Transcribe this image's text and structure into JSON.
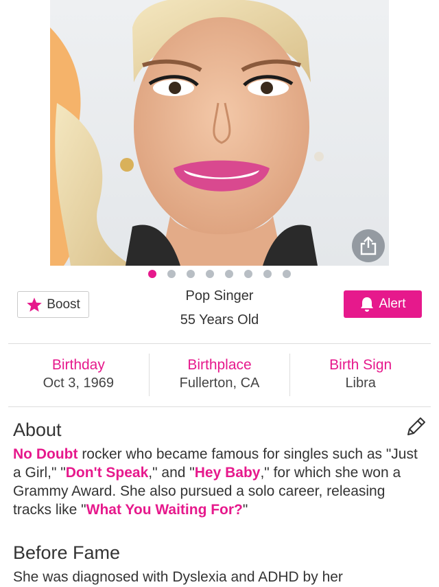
{
  "colors": {
    "accent": "#e6198c",
    "divider": "#dcdcdc",
    "text": "#333333"
  },
  "carousel": {
    "total": 8,
    "active_index": 0
  },
  "actions": {
    "boost_label": "Boost",
    "alert_label": "Alert"
  },
  "profile": {
    "occupation": "Pop Singer",
    "age": "55 Years Old"
  },
  "facts": [
    {
      "label": "Birthday",
      "value": "Oct 3, 1969"
    },
    {
      "label": "Birthplace",
      "value": "Fullerton, CA"
    },
    {
      "label": "Birth Sign",
      "value": "Libra"
    }
  ],
  "about": {
    "title": "About",
    "segments": [
      {
        "text": "No Doubt",
        "link": true
      },
      {
        "text": " rocker who became famous for singles such as \"Just a Girl,\" \"",
        "link": false
      },
      {
        "text": "Don't Speak",
        "link": true
      },
      {
        "text": ",\" and \"",
        "link": false
      },
      {
        "text": "Hey Baby",
        "link": true
      },
      {
        "text": ",\" for which she won a Grammy Award. She also pursued a solo career, releasing tracks like \"",
        "link": false
      },
      {
        "text": "What You Waiting For?",
        "link": true
      },
      {
        "text": "\"",
        "link": false
      }
    ]
  },
  "before_fame": {
    "title": "Before Fame",
    "text": "She was diagnosed with Dyslexia and ADHD by her"
  },
  "icons": {
    "share": "share-icon",
    "star": "star-icon",
    "bell": "bell-icon",
    "edit": "pencil-icon"
  }
}
